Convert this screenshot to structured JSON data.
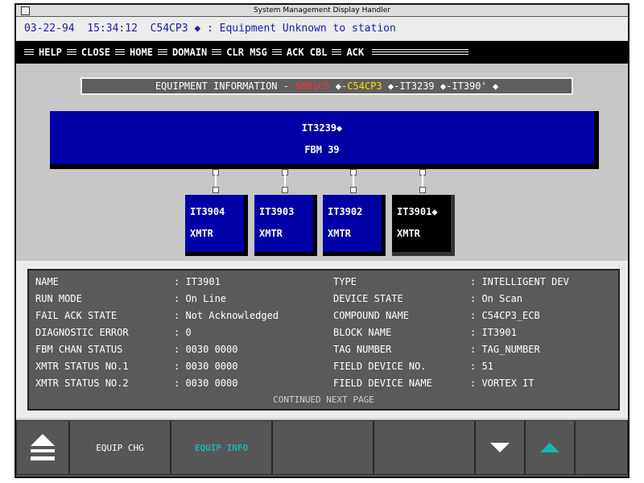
{
  "window": {
    "title": "System Management Display Handler"
  },
  "status": {
    "date": "03-22-94",
    "time": "15:34:12",
    "message": "C54CP3 ◆ : Equipment Unknown to station"
  },
  "menu": [
    {
      "label": "HELP"
    },
    {
      "label": "CLOSE"
    },
    {
      "label": "HOME"
    },
    {
      "label": "DOMAIN"
    },
    {
      "label": "CLR MSG"
    },
    {
      "label": "ACK CBL"
    },
    {
      "label": "ACK"
    }
  ],
  "banner": {
    "prefix": "EQUIPMENT INFORMATION -",
    "crumb1": "SMN1C5",
    "sep1": " ◆-",
    "crumb2": "C54CP3",
    "sep2": " ◆-",
    "crumb3": "IT3239",
    "sep3": " ◆-",
    "crumb4": "IT390'",
    "sep4": " ◆",
    "colors": {
      "crumb1": "#ff3030",
      "crumb2": "#ffe000",
      "rest": "#ffffff"
    }
  },
  "fbm": {
    "name": "IT3239◆",
    "label": "FBM 39"
  },
  "devices": [
    {
      "name": "IT3904",
      "type": "XMTR",
      "selected": false
    },
    {
      "name": "IT3903",
      "type": "XMTR",
      "selected": false
    },
    {
      "name": "IT3902",
      "type": "XMTR",
      "selected": false
    },
    {
      "name": "IT3901◆",
      "type": "XMTR",
      "selected": true
    }
  ],
  "details": {
    "left": [
      {
        "label": "NAME",
        "value": ": IT3901"
      },
      {
        "label": "RUN MODE",
        "value": ": On Line"
      },
      {
        "label": "FAIL ACK STATE",
        "value": ": Not Acknowledged"
      },
      {
        "label": "DIAGNOSTIC ERROR",
        "value": ": 0"
      },
      {
        "label": "FBM CHAN STATUS",
        "value": ": 0030 0000"
      },
      {
        "label": "XMTR STATUS NO.1",
        "value": ": 0030 0000"
      },
      {
        "label": "XMTR STATUS NO.2",
        "value": ": 0030 0000"
      }
    ],
    "right": [
      {
        "label": "TYPE",
        "value": ": INTELLIGENT DEV"
      },
      {
        "label": "DEVICE STATE",
        "value": ": On Scan"
      },
      {
        "label": "COMPOUND NAME",
        "value": ": C54CP3_ECB"
      },
      {
        "label": "BLOCK NAME",
        "value": ": IT3901"
      },
      {
        "label": "TAG NUMBER",
        "value": ": TAG_NUMBER"
      },
      {
        "label": "FIELD DEVICE NO.",
        "value": ": 51"
      },
      {
        "label": "FIELD DEVICE NAME",
        "value": ": VORTEX IT"
      }
    ],
    "continued": "CONTINUED NEXT PAGE"
  },
  "softkeys": [
    {
      "label": "",
      "icon": "page-up-icon"
    },
    {
      "label": "EQUIP CHG"
    },
    {
      "label": "EQUIP INFO",
      "active": true
    },
    {
      "label": ""
    },
    {
      "label": ""
    },
    {
      "label": "",
      "icon": "scroll-down-icon"
    },
    {
      "label": "",
      "icon": "scroll-up-icon"
    },
    {
      "label": ""
    }
  ]
}
